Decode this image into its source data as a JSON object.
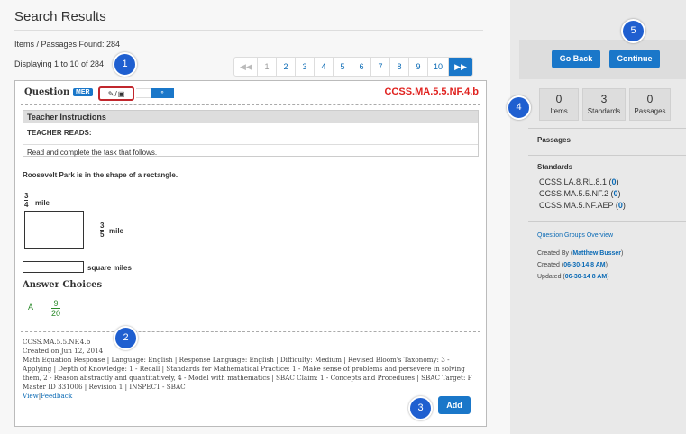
{
  "page": {
    "title": "Search Results",
    "found_label": "Items / Passages Found: 284",
    "displaying_label": "Displaying 1 to 10 of 284"
  },
  "pager": {
    "first_icon": "double-chevron-left-icon",
    "pages": [
      "1",
      "2",
      "3",
      "4",
      "5",
      "6",
      "7",
      "8",
      "9",
      "10"
    ],
    "current": "1",
    "last_icon": "double-chevron-right-icon"
  },
  "question": {
    "heading": "Question",
    "badge": "MER",
    "tool_icons": [
      "pencil-icon",
      "monitor-icon"
    ],
    "tool_sep": "/",
    "standard_code": "CCSS.MA.5.5.NF.4.b",
    "teacher_instructions_heading": "Teacher Instructions",
    "teacher_reads": "TEACHER READS:",
    "teacher_text": "Read and complete the task that follows.",
    "stem": "Roosevelt Park is in the shape of a rectangle.",
    "frac1": {
      "num": "3",
      "den": "4",
      "unit": "mile"
    },
    "frac2": {
      "num": "3",
      "den": "5",
      "unit": "mile"
    },
    "answer_unit": "square miles",
    "choices_heading": "Answer Choices",
    "choice": {
      "letter": "A",
      "num": "9",
      "den": "20"
    },
    "meta_code": "CCSS.MA.5.5.NF.4.b",
    "meta_created": "Created on Jun 12, 2014",
    "meta_details": "Math Equation Response | Language: English | Response Language: English | Difficulty: Medium | Revised Bloom's Taxonomy: 3 - Applying | Depth of Knowledge: 1 - Recall | Standards for Mathematical Practice: 1 - Make sense of problems and persevere in solving them, 2 - Reason abstractly and quantitatively, 4 - Model with mathematics | SBAC Claim: 1 - Concepts and Procedures | SBAC Target: F",
    "meta_master": "Master ID 331006 | Revision 1 | INSPECT - SBAC",
    "view_link": "View",
    "feedback_link": "Feedback",
    "add_label": "Add"
  },
  "sidebar": {
    "go_back_label": "Go Back",
    "continue_label": "Continue",
    "stats": [
      {
        "num": "0",
        "label": "Items"
      },
      {
        "num": "3",
        "label": "Standards"
      },
      {
        "num": "0",
        "label": "Passages"
      }
    ],
    "passages_heading": "Passages",
    "standards_heading": "Standards",
    "standards": [
      {
        "code": "CCSS.LA.8.RL.8.1",
        "count": "0"
      },
      {
        "code": "CCSS.MA.5.5.NF.2",
        "count": "0"
      },
      {
        "code": "CCSS.MA.5.NF.AEP",
        "count": "0"
      }
    ],
    "groups_link": "Question Groups Overview",
    "created_by_label": "Created By",
    "created_by_value": "Matthew Busser",
    "created_label": "Created",
    "created_value": "06-30-14 8 AM",
    "updated_label": "Updated",
    "updated_value": "06-30-14 8 AM"
  },
  "callouts": [
    "1",
    "2",
    "3",
    "4",
    "5"
  ]
}
